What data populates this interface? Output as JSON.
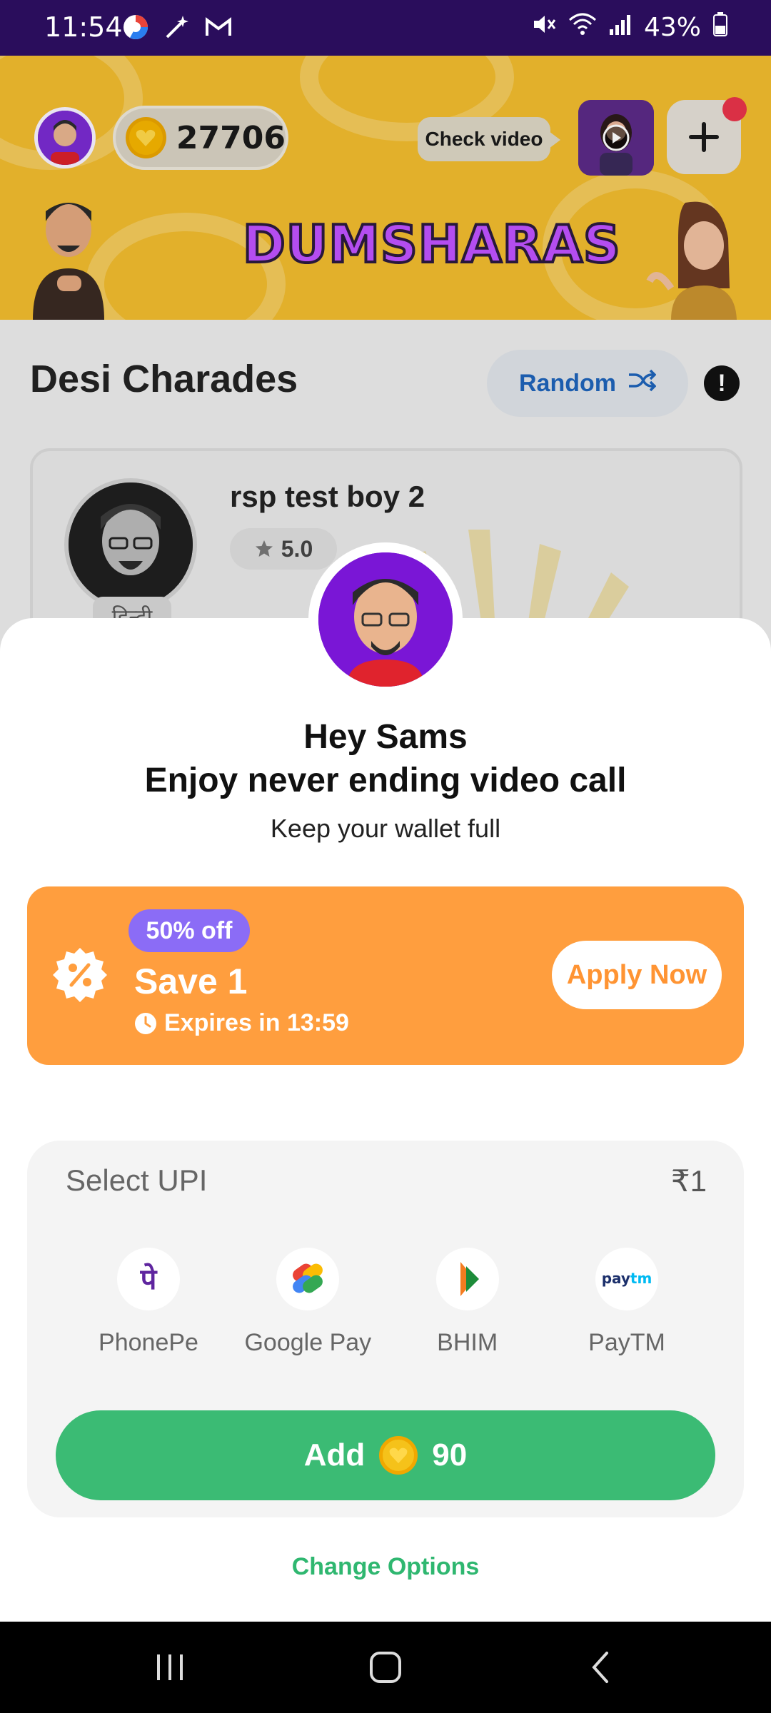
{
  "status_bar": {
    "time": "11:54",
    "battery": "43%"
  },
  "header": {
    "coin_balance": "27706",
    "check_video_label": "Check video",
    "logo_text": "DUMSHARAS"
  },
  "section": {
    "title": "Desi Charades",
    "random_label": "Random",
    "info_symbol": "!"
  },
  "host_card": {
    "name": "rsp test boy 2",
    "rating": "5.0",
    "language": "हिन्दी"
  },
  "sheet": {
    "greeting": "Hey Sams",
    "headline": "Enjoy never ending video call",
    "subline": "Keep your wallet full",
    "offer": {
      "badge": "50% off",
      "title": "Save 1",
      "expires": "Expires in 13:59",
      "apply_label": "Apply Now"
    },
    "upi": {
      "title": "Select UPI",
      "amount": "₹1",
      "options": [
        {
          "name": "PhonePe",
          "icon": "phonepe-icon"
        },
        {
          "name": "Google Pay",
          "icon": "google-pay-icon"
        },
        {
          "name": "BHIM",
          "icon": "bhim-icon"
        },
        {
          "name": "PayTM",
          "icon": "paytm-icon"
        }
      ],
      "add_label": "Add",
      "add_amount": "90"
    },
    "change_options": "Change Options"
  },
  "colors": {
    "status_bar": "#2a0d5c",
    "header_bg": "#f1bb2e",
    "offer_bg": "#ff9e3e",
    "badge_bg": "#8b6cf6",
    "add_button": "#3bbb74",
    "link_green": "#2fb770",
    "random_text": "#1e63b8"
  }
}
